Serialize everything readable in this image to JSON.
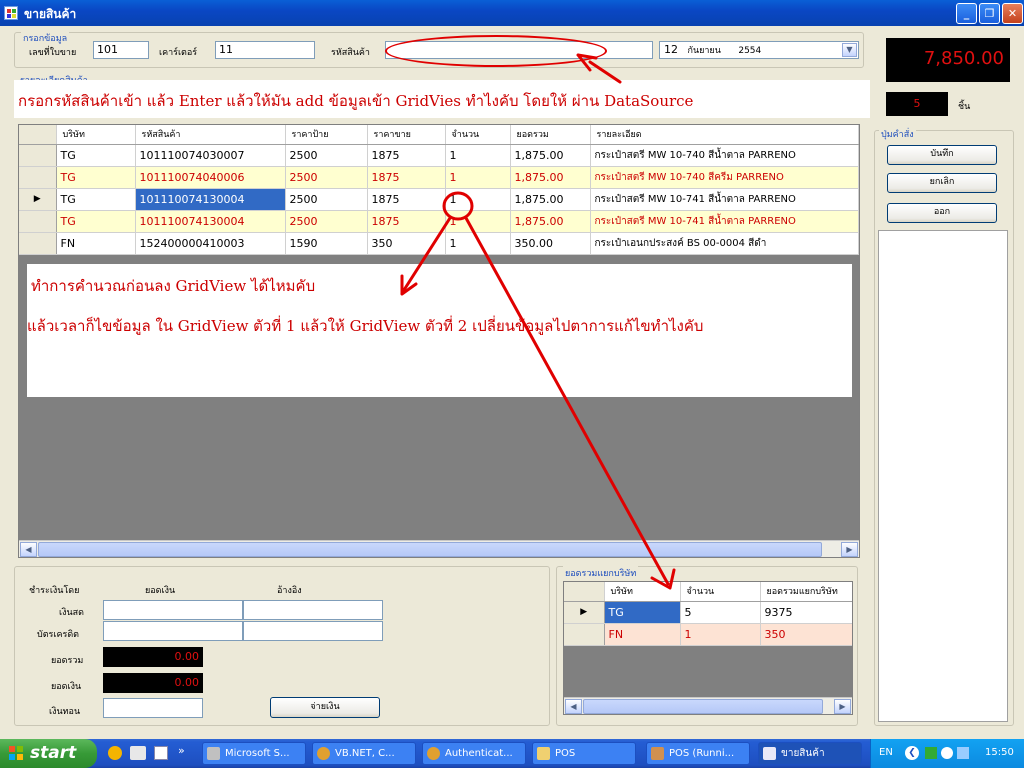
{
  "window": {
    "title": "ขายสินค้า"
  },
  "input_group": {
    "label": "กรอกข้อมูล",
    "sale_no_label": "เลขที่ใบขาย",
    "sale_no_value": "101",
    "counter_label": "เคาร์เตอร์",
    "counter_value": "11",
    "product_code_label": "รหัสสินค้า",
    "product_code_value": "",
    "date_day": "12",
    "date_month": "กันยายน",
    "date_year": "2554"
  },
  "total_display": "7,850.00",
  "qty_display": "5",
  "qty_unit": "ชิ้น",
  "commands": {
    "label": "ปุ่มคำสั่ง",
    "save": "บันทึก",
    "cancel": "ยกเลิก",
    "exit": "ออก"
  },
  "list_group_label": "รายละเอียดสินค้า",
  "grid": {
    "headers": [
      "บริษัท",
      "รหัสสินค้า",
      "ราคาป้าย",
      "ราคาขาย",
      "จำนวน",
      "ยอดรวม",
      "รายละเอียด"
    ],
    "rows": [
      [
        "TG",
        "101110074030007",
        "2500",
        "1875",
        "1",
        "1,875.00",
        "กระเป๋าสตรี MW 10-740 สีน้ำตาล PARRENO"
      ],
      [
        "TG",
        "101110074040006",
        "2500",
        "1875",
        "1",
        "1,875.00",
        "กระเป๋าสตรี MW 10-740 สีครีม PARRENO"
      ],
      [
        "TG",
        "101110074130004",
        "2500",
        "1875",
        "1",
        "1,875.00",
        "กระเป๋าสตรี MW 10-741 สีน้ำตาล PARRENO"
      ],
      [
        "TG",
        "101110074130004",
        "2500",
        "1875",
        "1",
        "1,875.00",
        "กระเป๋าสตรี MW 10-741 สีน้ำตาล PARRENO"
      ],
      [
        "FN",
        "152400000410003",
        "1590",
        "350",
        "1",
        "350.00",
        "กระเป๋าเอนกประสงค์ BS 00-0004 สีดำ"
      ]
    ]
  },
  "annotations": {
    "top": "กรอกรหัสสินค้าเข้า แล้ว Enter แล้วให้มัน add ข้อมูลเข้า GridVies ทำไงคับ โดยให้ ผ่าน  DataSource",
    "mid1": "ทำการคำนวณก่อนลง GridView ได้ไหมคับ",
    "mid2": "แล้วเวลาก็ไขข้อมูล ใน GridView ตัวที่ 1 แล้วให้ GridView ตัวที่ 2 เปลี่ยนข้อมูลไปตาการแก้ไขทำไงคับ"
  },
  "payment": {
    "pay_by_label": "ชำระเงินโดย",
    "amount_header": "ยอดเงิน",
    "ref_header": "อ้างอิง",
    "cash_label": "เงินสด",
    "credit_label": "บัตรเครดิต",
    "total_label": "ยอดรวม",
    "total_value": "0.00",
    "paid_label": "ยอดเงิน",
    "paid_value": "0.00",
    "change_label": "เงินทอน",
    "pay_button": "จ่ายเงิน"
  },
  "summary": {
    "label": "ยอดรวมแยกบริษัท",
    "headers": [
      "บริษัท",
      "จำนวน",
      "ยอดรวมแยกบริษัท"
    ],
    "rows": [
      [
        "TG",
        "5",
        "9375"
      ],
      [
        "FN",
        "1",
        "350"
      ]
    ]
  },
  "taskbar": {
    "start": "start",
    "tasks": [
      "Microsoft S...",
      "VB.NET, C...",
      "Authenticat...",
      "POS",
      "POS (Runni...",
      "ขายสินค้า"
    ],
    "lang": "EN",
    "clock": "15:50"
  }
}
